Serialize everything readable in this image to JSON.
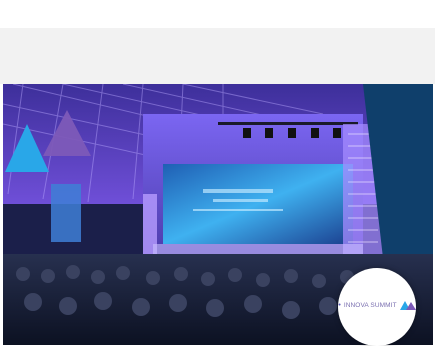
{
  "hero": {
    "colors": {
      "stage_light": "#8a7cff",
      "screen": "#2a8de0",
      "corner_panel": "#0f3f6b",
      "logo_blue": "#29a7e8",
      "logo_purple": "#7d5ab8"
    },
    "badge": {
      "text": "INNOVA SUMMIT",
      "icon": "summit-logo-icon"
    }
  }
}
